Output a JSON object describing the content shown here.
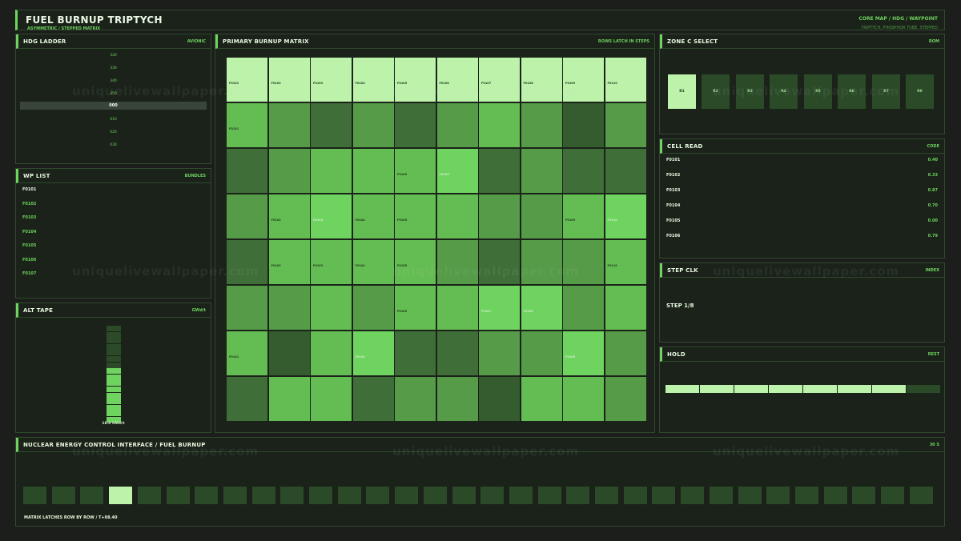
{
  "header": {
    "title": "FUEL BURNUP TRIPTYCH",
    "subtitle": "ASYMMETRIC / STEPPED MATRIX",
    "nav": "CORE MAP  /  HDG  /  WAYPOINT",
    "nav_sub": "TRIPTYCH, PHOSPHOR TUBE, STEPPED"
  },
  "hdg": {
    "title": "HDG LADDER",
    "tag": "AVIONIC",
    "marks": [
      "330",
      "340",
      "350",
      "000",
      "010",
      "020",
      "030"
    ],
    "top_mark": "320",
    "selected": "000"
  },
  "wp": {
    "title": "WP LIST",
    "tag": "BUNDLES",
    "items": [
      "F0101",
      "F0102",
      "F0103",
      "F0104",
      "F0105",
      "F0106",
      "F0107"
    ],
    "active_index": 0
  },
  "alt": {
    "title": "ALT TAPE",
    "tag": "GWd/t",
    "readout": "18.0 GWd/t",
    "level_fraction": 0.55
  },
  "matrix": {
    "title": "PRIMARY  BURNUP MATRIX",
    "tag": "ROWS LATCH IN STEPS",
    "row0_labels": [
      "F0101",
      "F0102",
      "F0103",
      "F0104",
      "F0105",
      "F0106",
      "F0107",
      "F0108",
      "F0109",
      "F0110"
    ]
  },
  "zone": {
    "title": "ZONE C  SELECT",
    "tag": "ROM",
    "items": [
      "R1",
      "R2",
      "R3",
      "R4",
      "R5",
      "R6",
      "R7",
      "R8"
    ],
    "selected_index": 0
  },
  "cell_read": {
    "title": "CELL READ",
    "tag": "CODE",
    "rows": [
      {
        "key": "F0101",
        "value": "0.40"
      },
      {
        "key": "F0102",
        "value": "0.33"
      },
      {
        "key": "F0103",
        "value": "0.87"
      },
      {
        "key": "F0104",
        "value": "0.70"
      },
      {
        "key": "F0105",
        "value": "0.00"
      },
      {
        "key": "F0106",
        "value": "0.79"
      }
    ]
  },
  "step": {
    "title": "STEP CLK",
    "tag": "INDEX",
    "value": "STEP 1/8"
  },
  "hold": {
    "title": "HOLD",
    "tag": "REST",
    "filled_segments": 7,
    "total_segments": 8
  },
  "bottom": {
    "title": "NUCLEAR ENERGY CONTROL INTERFACE  /  FUEL BURNUP",
    "tag": "30 S",
    "status": "MATRIX LATCHES ROW BY ROW  /  T+08.40",
    "total_cells": 32,
    "selected_index": 3
  },
  "watermark": "uniquelivewallpaper.com",
  "colors": {
    "accent": "#6fd35f",
    "cell_bright": "#bdf2ab",
    "cell_dark": "#2b4a28"
  }
}
